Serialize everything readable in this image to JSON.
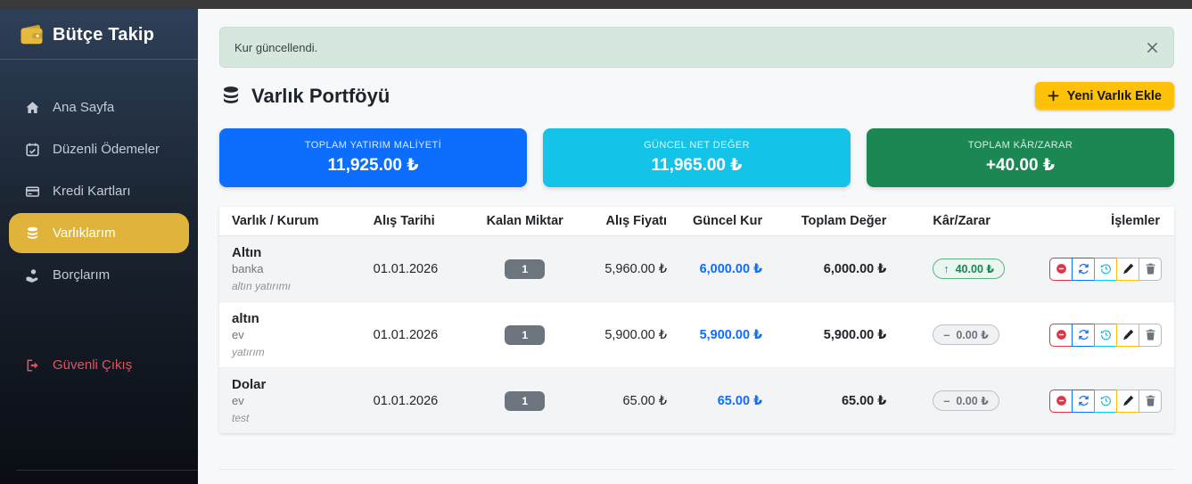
{
  "app": {
    "title": "Bütçe Takip"
  },
  "sidebar": {
    "items": [
      {
        "label": "Ana Sayfa",
        "icon": "home-icon"
      },
      {
        "label": "Düzenli Ödemeler",
        "icon": "calendar-check-icon"
      },
      {
        "label": "Kredi Kartları",
        "icon": "credit-card-icon"
      },
      {
        "label": "Varlıklarım",
        "icon": "coins-icon",
        "active": true
      },
      {
        "label": "Borçlarım",
        "icon": "hand-holding-coin-icon"
      }
    ],
    "logout": {
      "label": "Güvenli Çıkış",
      "icon": "logout-icon",
      "color": "#e0535f"
    },
    "active_color": "#e0b43a"
  },
  "alert": {
    "message": "Kur güncellendi."
  },
  "header": {
    "title": "Varlık Portföyü",
    "add_button": {
      "label": "Yeni Varlık Ekle",
      "color": "#ffc107"
    }
  },
  "summary_cards": [
    {
      "label": "TOPLAM YATIRIM MALİYETİ",
      "value": "11,925.00 ₺",
      "color": "#0d6efd"
    },
    {
      "label": "GÜNCEL NET DEĞER",
      "value": "11,965.00 ₺",
      "color": "#13c4e8"
    },
    {
      "label": "TOPLAM KÂR/ZARAR",
      "value": "+40.00 ₺",
      "color": "#1b8752"
    }
  ],
  "table": {
    "headers": [
      "Varlık / Kurum",
      "Alış Tarihi",
      "Kalan Miktar",
      "Alış Fiyatı",
      "Güncel Kur",
      "Toplam Değer",
      "Kâr/Zarar",
      "İşlemler"
    ],
    "action_icons": [
      "sell-circle-icon",
      "refresh-icon",
      "history-icon",
      "edit-pencil-icon",
      "delete-trash-icon"
    ],
    "rows": [
      {
        "name": "Altın",
        "institution": "banka",
        "note": "altın yatırımı",
        "purchase_date": "01.01.2026",
        "remaining_qty": "1",
        "purchase_price": "5,960.00 ₺",
        "current_rate": "6,000.00 ₺",
        "total_value": "6,000.00 ₺",
        "profit_loss": {
          "icon": "↑",
          "value": "40.00 ₺",
          "state": "up"
        }
      },
      {
        "name": "altın",
        "institution": "ev",
        "note": "yatırım",
        "purchase_date": "01.01.2026",
        "remaining_qty": "1",
        "purchase_price": "5,900.00 ₺",
        "current_rate": "5,900.00 ₺",
        "total_value": "5,900.00 ₺",
        "profit_loss": {
          "icon": "–",
          "value": "0.00 ₺",
          "state": "flat"
        }
      },
      {
        "name": "Dolar",
        "institution": "ev",
        "note": "test",
        "purchase_date": "01.01.2026",
        "remaining_qty": "1",
        "purchase_price": "65.00 ₺",
        "current_rate": "65.00 ₺",
        "total_value": "65.00 ₺",
        "profit_loss": {
          "icon": "–",
          "value": "0.00 ₺",
          "state": "flat"
        }
      }
    ]
  }
}
